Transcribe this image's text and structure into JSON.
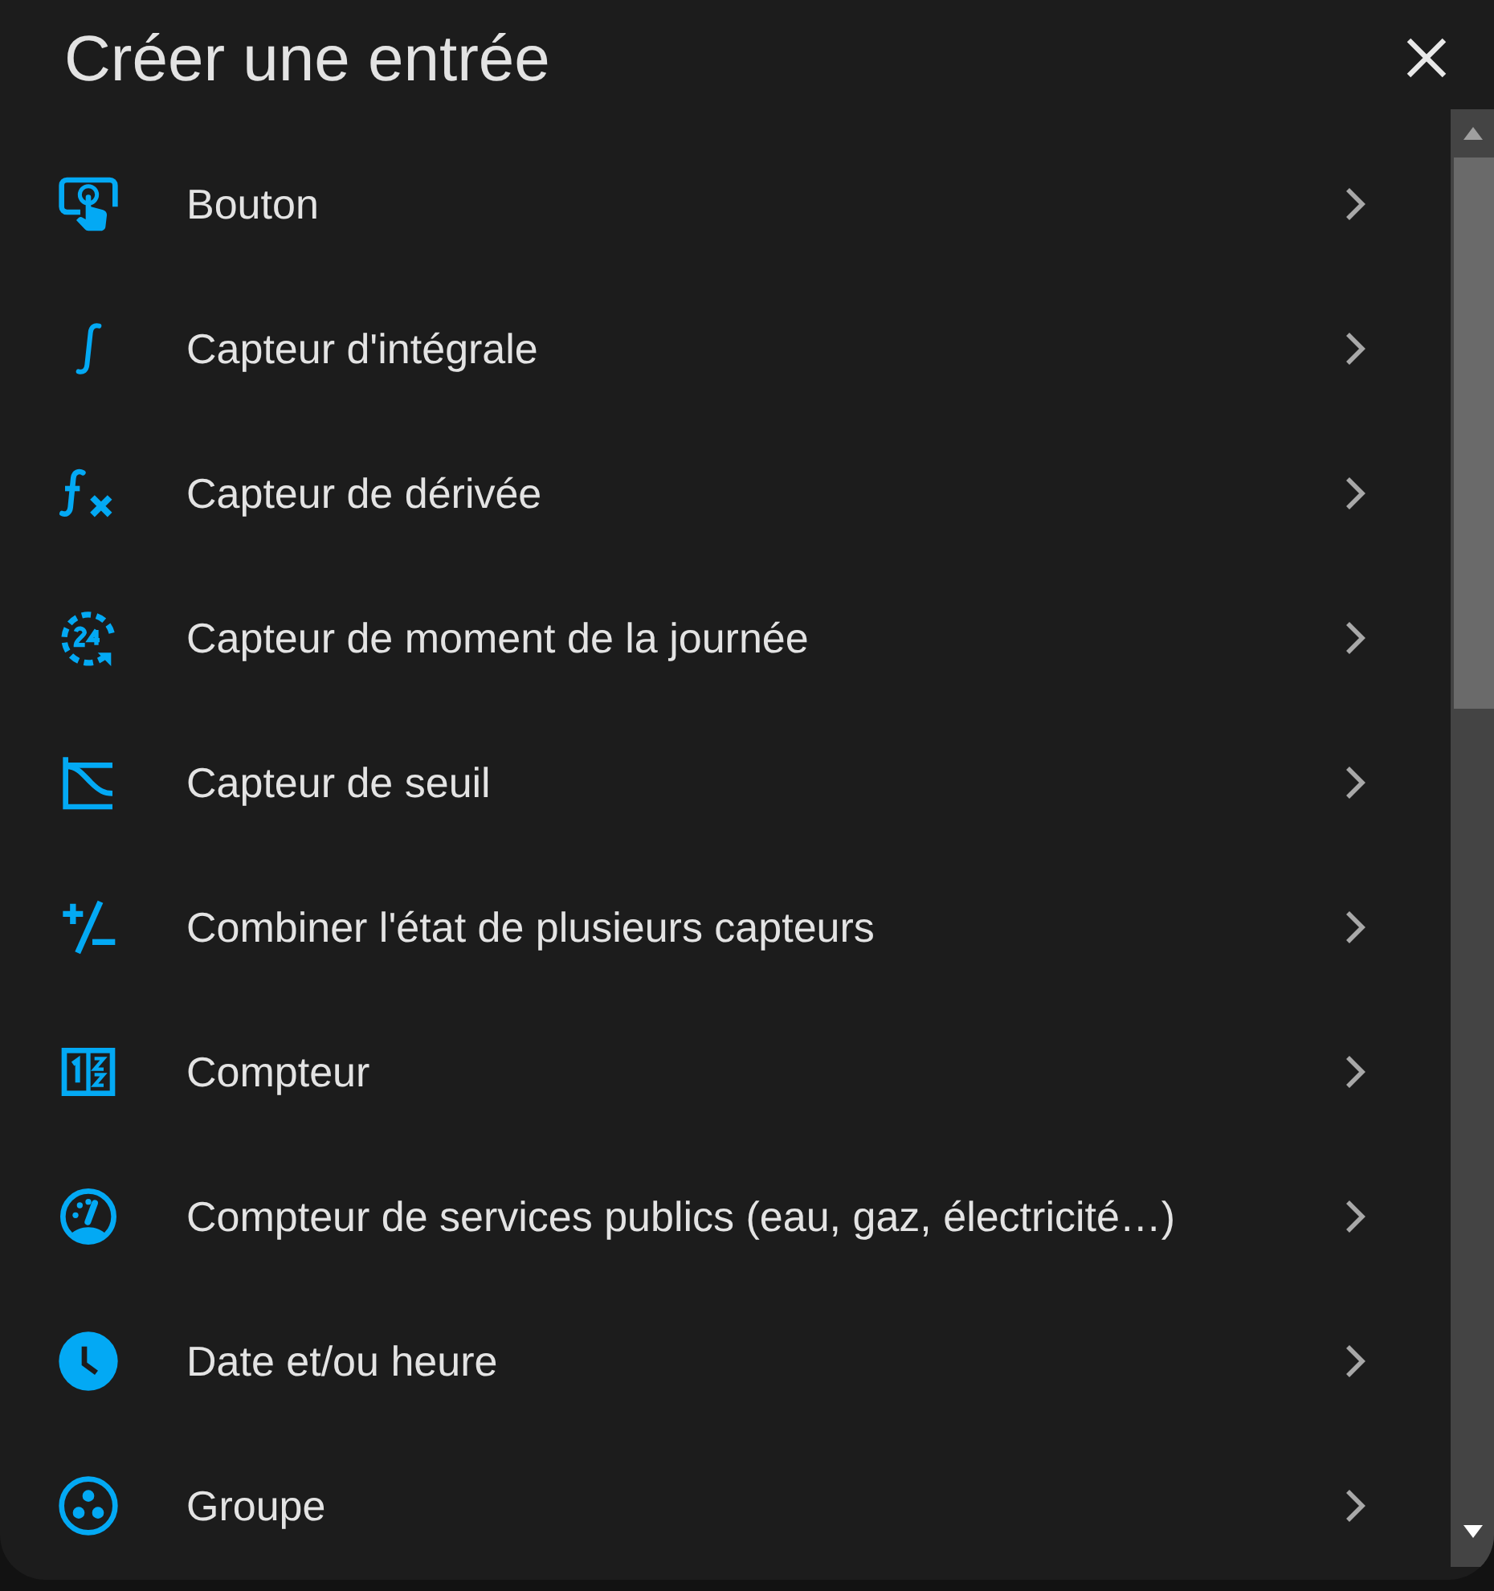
{
  "dialog": {
    "title": "Créer une entrée"
  },
  "items": [
    {
      "label": "Bouton"
    },
    {
      "label": "Capteur d'intégrale"
    },
    {
      "label": "Capteur de dérivée"
    },
    {
      "label": "Capteur de moment de la journée"
    },
    {
      "label": "Capteur de seuil"
    },
    {
      "label": "Combiner l'état de plusieurs capteurs"
    },
    {
      "label": "Compteur"
    },
    {
      "label": "Compteur de services publics (eau, gaz, électricité…)"
    },
    {
      "label": "Date et/ou heure"
    },
    {
      "label": "Groupe"
    }
  ]
}
